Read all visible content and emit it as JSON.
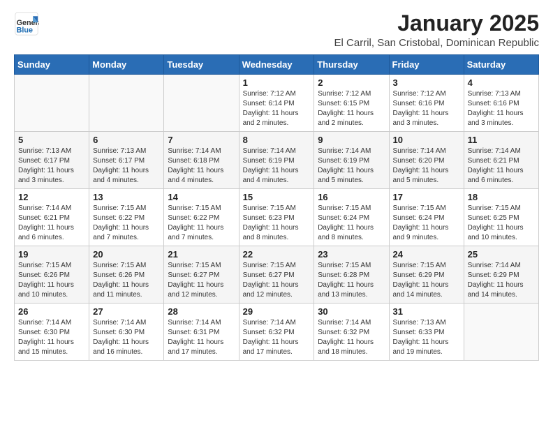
{
  "header": {
    "logo_general": "General",
    "logo_blue": "Blue",
    "month": "January 2025",
    "location": "El Carril, San Cristobal, Dominican Republic"
  },
  "days_of_week": [
    "Sunday",
    "Monday",
    "Tuesday",
    "Wednesday",
    "Thursday",
    "Friday",
    "Saturday"
  ],
  "weeks": [
    [
      {
        "day": "",
        "info": ""
      },
      {
        "day": "",
        "info": ""
      },
      {
        "day": "",
        "info": ""
      },
      {
        "day": "1",
        "info": "Sunrise: 7:12 AM\nSunset: 6:14 PM\nDaylight: 11 hours and 2 minutes."
      },
      {
        "day": "2",
        "info": "Sunrise: 7:12 AM\nSunset: 6:15 PM\nDaylight: 11 hours and 2 minutes."
      },
      {
        "day": "3",
        "info": "Sunrise: 7:12 AM\nSunset: 6:16 PM\nDaylight: 11 hours and 3 minutes."
      },
      {
        "day": "4",
        "info": "Sunrise: 7:13 AM\nSunset: 6:16 PM\nDaylight: 11 hours and 3 minutes."
      }
    ],
    [
      {
        "day": "5",
        "info": "Sunrise: 7:13 AM\nSunset: 6:17 PM\nDaylight: 11 hours and 3 minutes."
      },
      {
        "day": "6",
        "info": "Sunrise: 7:13 AM\nSunset: 6:17 PM\nDaylight: 11 hours and 4 minutes."
      },
      {
        "day": "7",
        "info": "Sunrise: 7:14 AM\nSunset: 6:18 PM\nDaylight: 11 hours and 4 minutes."
      },
      {
        "day": "8",
        "info": "Sunrise: 7:14 AM\nSunset: 6:19 PM\nDaylight: 11 hours and 4 minutes."
      },
      {
        "day": "9",
        "info": "Sunrise: 7:14 AM\nSunset: 6:19 PM\nDaylight: 11 hours and 5 minutes."
      },
      {
        "day": "10",
        "info": "Sunrise: 7:14 AM\nSunset: 6:20 PM\nDaylight: 11 hours and 5 minutes."
      },
      {
        "day": "11",
        "info": "Sunrise: 7:14 AM\nSunset: 6:21 PM\nDaylight: 11 hours and 6 minutes."
      }
    ],
    [
      {
        "day": "12",
        "info": "Sunrise: 7:14 AM\nSunset: 6:21 PM\nDaylight: 11 hours and 6 minutes."
      },
      {
        "day": "13",
        "info": "Sunrise: 7:15 AM\nSunset: 6:22 PM\nDaylight: 11 hours and 7 minutes."
      },
      {
        "day": "14",
        "info": "Sunrise: 7:15 AM\nSunset: 6:22 PM\nDaylight: 11 hours and 7 minutes."
      },
      {
        "day": "15",
        "info": "Sunrise: 7:15 AM\nSunset: 6:23 PM\nDaylight: 11 hours and 8 minutes."
      },
      {
        "day": "16",
        "info": "Sunrise: 7:15 AM\nSunset: 6:24 PM\nDaylight: 11 hours and 8 minutes."
      },
      {
        "day": "17",
        "info": "Sunrise: 7:15 AM\nSunset: 6:24 PM\nDaylight: 11 hours and 9 minutes."
      },
      {
        "day": "18",
        "info": "Sunrise: 7:15 AM\nSunset: 6:25 PM\nDaylight: 11 hours and 10 minutes."
      }
    ],
    [
      {
        "day": "19",
        "info": "Sunrise: 7:15 AM\nSunset: 6:26 PM\nDaylight: 11 hours and 10 minutes."
      },
      {
        "day": "20",
        "info": "Sunrise: 7:15 AM\nSunset: 6:26 PM\nDaylight: 11 hours and 11 minutes."
      },
      {
        "day": "21",
        "info": "Sunrise: 7:15 AM\nSunset: 6:27 PM\nDaylight: 11 hours and 12 minutes."
      },
      {
        "day": "22",
        "info": "Sunrise: 7:15 AM\nSunset: 6:27 PM\nDaylight: 11 hours and 12 minutes."
      },
      {
        "day": "23",
        "info": "Sunrise: 7:15 AM\nSunset: 6:28 PM\nDaylight: 11 hours and 13 minutes."
      },
      {
        "day": "24",
        "info": "Sunrise: 7:15 AM\nSunset: 6:29 PM\nDaylight: 11 hours and 14 minutes."
      },
      {
        "day": "25",
        "info": "Sunrise: 7:14 AM\nSunset: 6:29 PM\nDaylight: 11 hours and 14 minutes."
      }
    ],
    [
      {
        "day": "26",
        "info": "Sunrise: 7:14 AM\nSunset: 6:30 PM\nDaylight: 11 hours and 15 minutes."
      },
      {
        "day": "27",
        "info": "Sunrise: 7:14 AM\nSunset: 6:30 PM\nDaylight: 11 hours and 16 minutes."
      },
      {
        "day": "28",
        "info": "Sunrise: 7:14 AM\nSunset: 6:31 PM\nDaylight: 11 hours and 17 minutes."
      },
      {
        "day": "29",
        "info": "Sunrise: 7:14 AM\nSunset: 6:32 PM\nDaylight: 11 hours and 17 minutes."
      },
      {
        "day": "30",
        "info": "Sunrise: 7:14 AM\nSunset: 6:32 PM\nDaylight: 11 hours and 18 minutes."
      },
      {
        "day": "31",
        "info": "Sunrise: 7:13 AM\nSunset: 6:33 PM\nDaylight: 11 hours and 19 minutes."
      },
      {
        "day": "",
        "info": ""
      }
    ]
  ]
}
